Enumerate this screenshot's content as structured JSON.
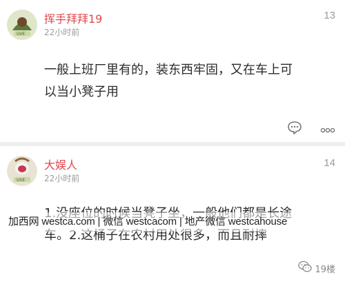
{
  "posts": [
    {
      "username": "挥手拜拜19",
      "time": "22小时前",
      "floor": "13",
      "content_lines": [
        "一般上班厂里有的，装东西牢固，又在车上可",
        "以当小凳子用"
      ],
      "avatar_icon": "avatar-image"
    },
    {
      "username": "大娱人",
      "time": "22小时前",
      "floor": "14",
      "content_lines": [
        "1.没座位的时候当凳子坐，一般他们都是长途",
        "车。2.这桶子在农村用处很多，而且耐摔"
      ],
      "avatar_icon": "avatar-image"
    }
  ],
  "actions": {
    "comment_icon": "comment-icon",
    "more_icon": "more-icon"
  },
  "watermark": "加西网 westca.com | 微信 westcacom | 地产微信 westcahouse",
  "badge": {
    "icon": "wechat-icon",
    "text": "19楼"
  },
  "colors": {
    "username": "#e0484e",
    "meta": "#9a9a9a",
    "divider": "#eeeeee"
  }
}
